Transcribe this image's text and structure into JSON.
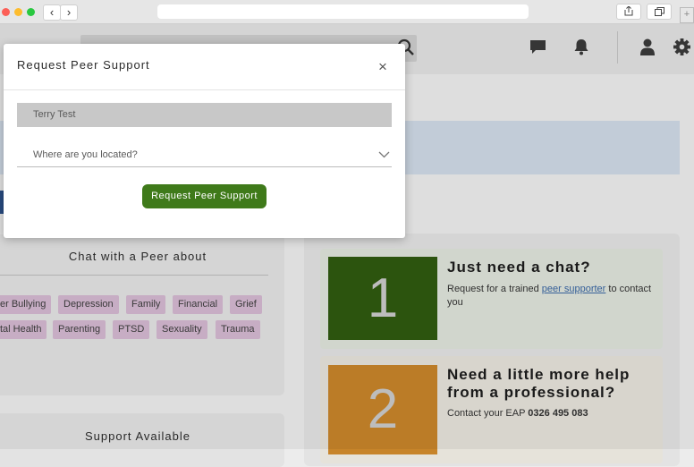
{
  "browser": {
    "back": "‹",
    "forward": "›",
    "new_tab": "+"
  },
  "modal": {
    "title": "Request Peer Support",
    "close": "×",
    "name_value": "Terry Test",
    "location_placeholder": "Where are you located?",
    "submit_label": "Request Peer Support"
  },
  "chat_card": {
    "title": "Chat with a Peer about",
    "tags": [
      "er Bullying",
      "Depression",
      "Family",
      "Financial",
      "Grief",
      "tal Health",
      "Parenting",
      "PTSD",
      "Sexuality",
      "Trauma"
    ]
  },
  "support_card": {
    "title": "Support Available"
  },
  "steps": [
    {
      "number": "1",
      "title": "Just need a chat?",
      "text_before": "Request for a trained",
      "link": "peer supporter",
      "text_after": "to contact you",
      "color": "#2f5a0f"
    },
    {
      "number": "2",
      "title_line1": "Need a little more help",
      "title_line2": "from a professional?",
      "text": "Contact your EAP",
      "phone": "0326 495 083",
      "color": "#c7842a"
    }
  ],
  "colors": {
    "accent_green": "#3f7a1a",
    "tag_pink": "#d4b8d1",
    "banner_blue": "#cfd9e6"
  }
}
